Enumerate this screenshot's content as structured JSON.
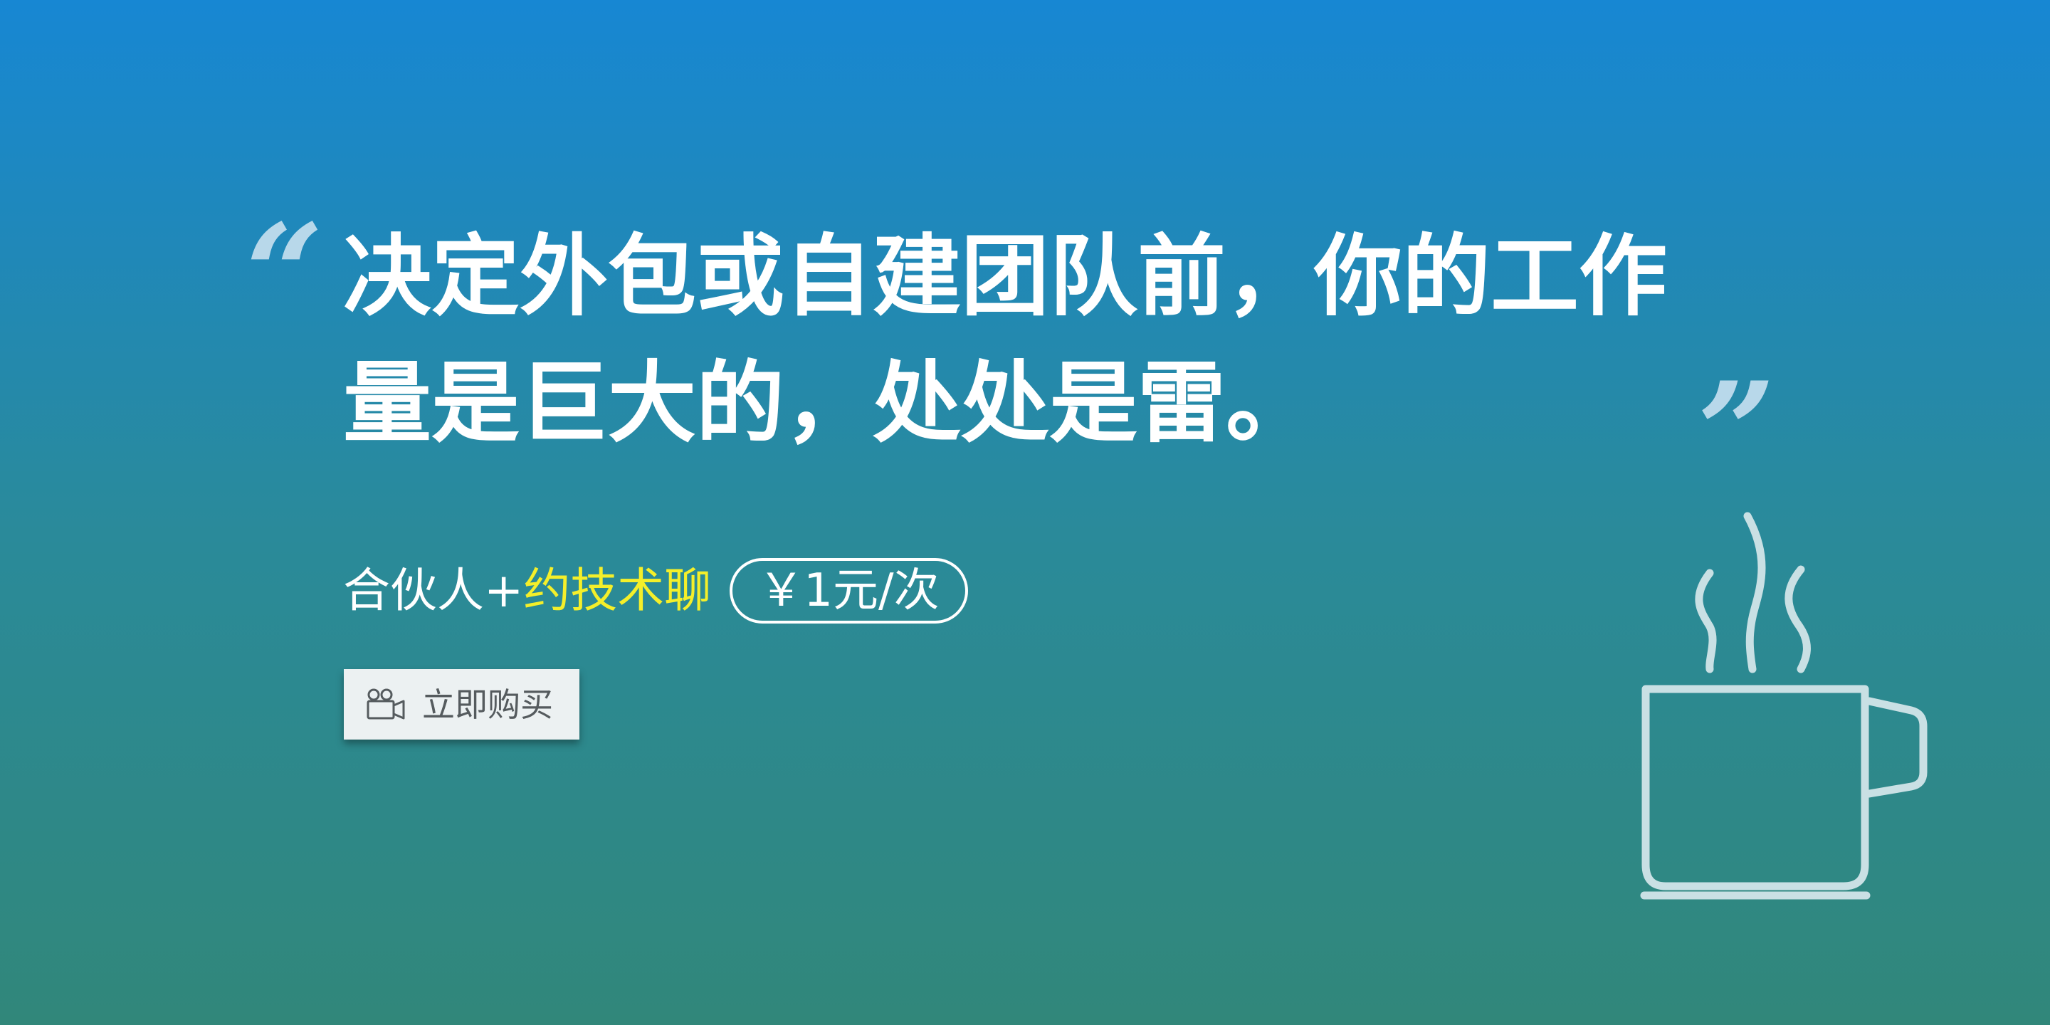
{
  "banner": {
    "quote_open": "“",
    "quote_close": "”",
    "headline_line1": "决定外包或自建团队前，你的工作",
    "headline_line2": "量是巨大的，处处是雷。",
    "promo_lead": "合伙人+",
    "promo_highlight": "约技术聊",
    "price_label": "￥1元/次",
    "buy_button_label": "立即购买",
    "buy_button_icon": "video-camera-icon",
    "decoration_icon": "coffee-cup-icon"
  },
  "colors": {
    "gradient_top": "#1787d3",
    "gradient_bottom": "#31877a",
    "highlight": "#f4ef2a",
    "text": "#ffffff",
    "quote_mark": "#b8d8ea",
    "cup_stroke": "#c9e0e4",
    "button_bg": "#ecf1f2",
    "button_text": "#555b5e"
  }
}
